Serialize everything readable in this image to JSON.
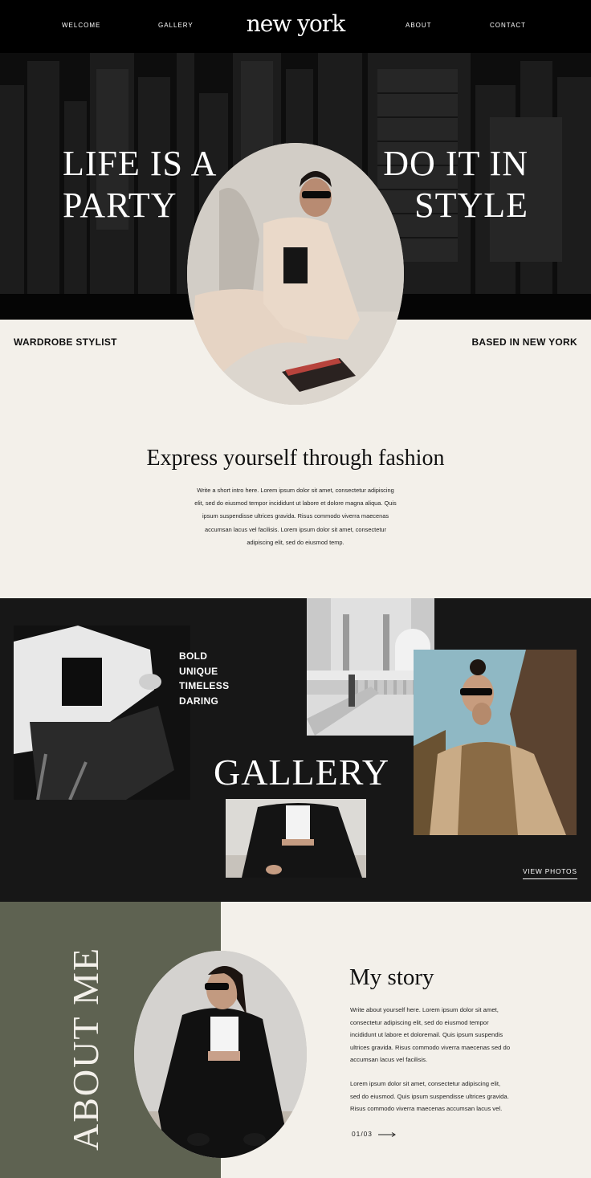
{
  "nav": {
    "links": [
      "WELCOME",
      "GALLERY",
      "ABOUT",
      "CONTACT"
    ],
    "logo": "new york"
  },
  "hero": {
    "left_line1": "LIFE IS A",
    "left_line2": "PARTY",
    "right_line1": "DO IT IN",
    "right_line2": "STYLE",
    "tagline_left": "WARDROBE STYLIST",
    "tagline_right": "BASED IN NEW YORK"
  },
  "intro": {
    "heading": "Express yourself through fashion",
    "body_lines": [
      "Write a short intro here. Lorem ipsum dolor sit amet, consectetur adipiscing",
      "elit, sed do eiusmod tempor incididunt ut labore et dolore magna aliqua. Quis",
      "ipsum suspendisse ultrices gravida. Risus commodo viverra maecenas",
      "accumsan lacus vel facilisis.  Lorem ipsum dolor sit amet, consectetur",
      "adipiscing elit, sed do eiusmod temp."
    ]
  },
  "gallery": {
    "traits": [
      "BOLD",
      "UNIQUE",
      "TIMELESS",
      "DARING"
    ],
    "title": "GALLERY",
    "cta": "VIEW PHOTOS"
  },
  "about": {
    "vertical_title": "ABOUT ME",
    "story_title": "My story",
    "paragraph1_lines": [
      "Write about yourself here. Lorem ipsum dolor sit amet,",
      "consectetur adipiscing elit, sed do eiusmod tempor",
      "incididunt ut labore et doloremail. Quis ipsum suspendis",
      "ultrices gravida. Risus commodo viverra maecenas sed do",
      "accumsan lacus vel facilisis."
    ],
    "paragraph2_lines": [
      "Lorem ipsum dolor sit amet, consectetur adipiscing elit,",
      "sed do eiusmod. Quis ipsum suspendisse ultrices gravida.",
      "Risus commodo viverra maecenas accumsan lacus vel."
    ],
    "pager": "01/03"
  },
  "colors": {
    "black": "#000000",
    "cream": "#f3f0ea",
    "gallery_bg": "#171717",
    "olive": "#5e6251"
  }
}
